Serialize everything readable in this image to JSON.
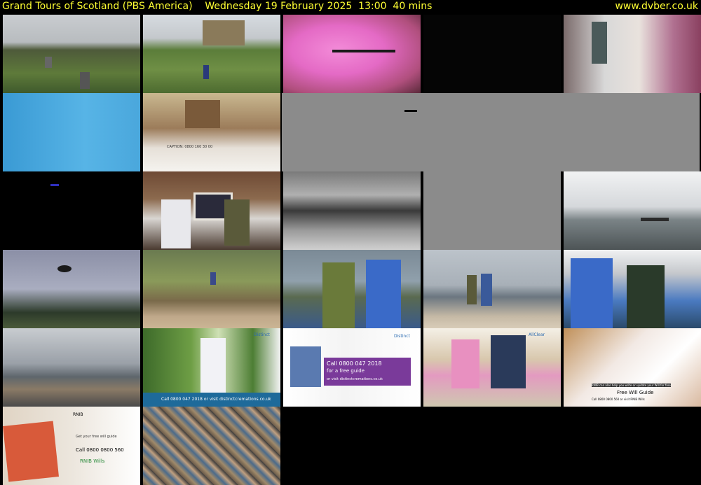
{
  "header": {
    "title": "Grand Tours of Scotland (PBS America)    Wednesday 19 February 2025  13:00  40 mins",
    "site": "www.dvber.co.uk"
  },
  "thumbnails": [
    {
      "style": "t-cemetery"
    },
    {
      "style": "t-hill"
    },
    {
      "style": "t-pink"
    },
    {
      "style": "t-dark"
    },
    {
      "style": "t-street"
    },
    {
      "style": "t-blue"
    },
    {
      "style": "t-tea",
      "caption": "CAPTION: 0800 160 30 00"
    },
    {
      "style": "t-gray",
      "wide": true
    },
    {
      "style": "t-black"
    },
    {
      "style": "t-room"
    },
    {
      "style": "t-beach"
    },
    {
      "style": "t-gray"
    },
    {
      "style": "t-sea1"
    },
    {
      "style": "t-sky"
    },
    {
      "style": "t-reeds"
    },
    {
      "style": "t-couple1"
    },
    {
      "style": "t-walk"
    },
    {
      "style": "t-couple2"
    },
    {
      "style": "t-rocks"
    },
    {
      "style": "t-garden",
      "ad": "Call 0800 047 2018 or visit distinctcremations.co.uk",
      "brand": "Distinct"
    },
    {
      "style": "t-ad",
      "ad_line1": "Call 0800 047 2018",
      "ad_line2": "for a free guide",
      "ad_line3": "or visit distinctcremations.co.uk",
      "brand": "Distinct"
    },
    {
      "style": "t-kitchen",
      "brand": "AllClear"
    },
    {
      "style": "t-paper",
      "ad_line1": "RNIB can also help you write or update your Will for free",
      "ad_line2": "Free Will Guide",
      "ad_line3": "Call 0800 0800 560 or visit RNIB Wills"
    },
    {
      "style": "t-booklet",
      "brand": "RNIB",
      "ad_line1": "Get your free will guide",
      "ad_line2": "Call 0800 0800 560",
      "ad_line3": "RNIB Wills"
    },
    {
      "style": "t-mosaic"
    }
  ]
}
